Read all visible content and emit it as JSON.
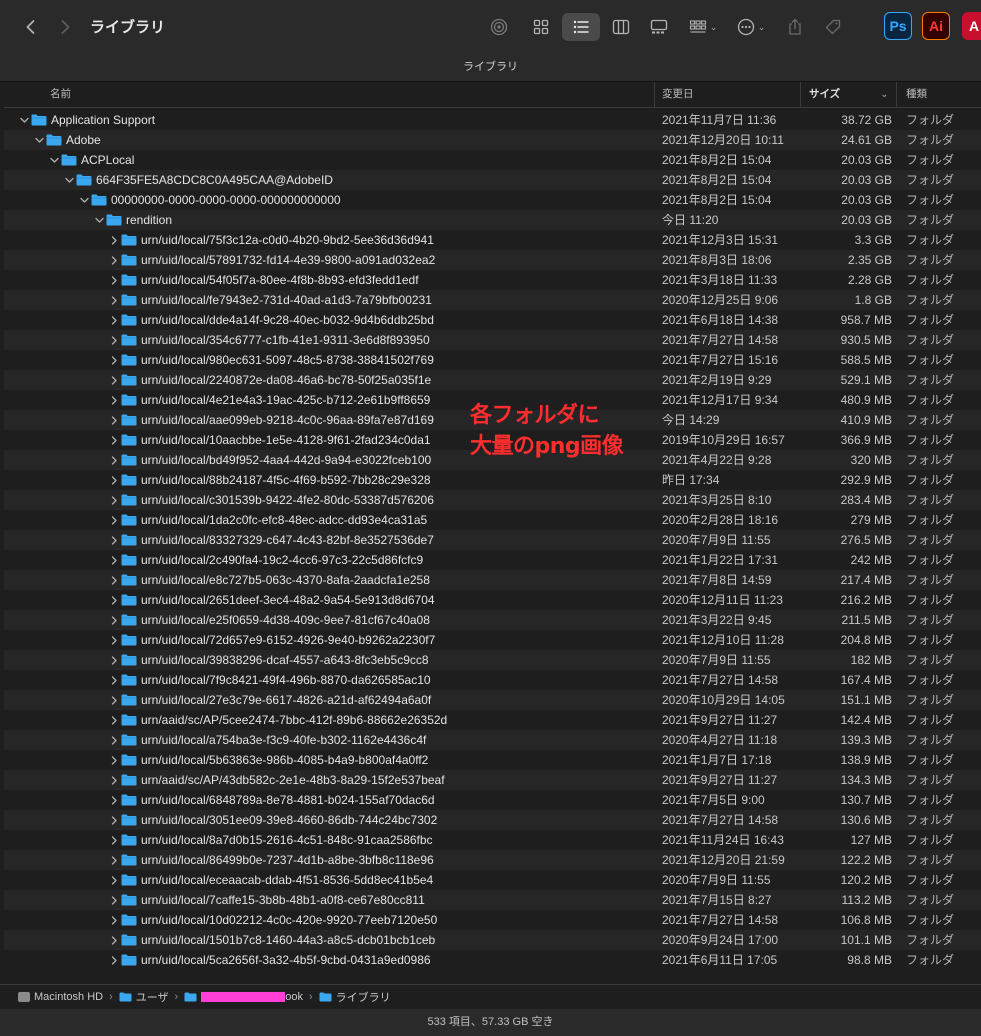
{
  "window": {
    "title": "ライブラリ",
    "path_title": "ライブラリ",
    "status_text": "533 項目、57.33 GB 空き",
    "accent_folder_color": "#3aa8f0"
  },
  "toolbar": {
    "back_icon": "chevron-left-icon",
    "forward_icon": "chevron-right-icon",
    "chevron_glyph": "⌄"
  },
  "apps": {
    "ps_label": "Ps",
    "ai_label": "Ai",
    "acrobat_label": "A"
  },
  "columns": {
    "name": "名前",
    "date": "変更日",
    "size": "サイズ",
    "kind": "種類",
    "sort_glyph": "⌄"
  },
  "annotation": {
    "line1": "各フォルダに",
    "line2": "大量のpng画像"
  },
  "pathbar": {
    "disk": "Macintosh HD",
    "users": "ユーザ",
    "user_suffix": "ook",
    "library": "ライブラリ"
  },
  "rows": [
    {
      "name": "Application Support",
      "date": "2021年11月7日 11:36",
      "size": "38.72 GB",
      "kind": "フォルダ",
      "level": 0,
      "expanded": true
    },
    {
      "name": "Adobe",
      "date": "2021年12月20日 10:11",
      "size": "24.61 GB",
      "kind": "フォルダ",
      "level": 1,
      "expanded": true
    },
    {
      "name": "ACPLocal",
      "date": "2021年8月2日 15:04",
      "size": "20.03 GB",
      "kind": "フォルダ",
      "level": 2,
      "expanded": true
    },
    {
      "name": "664F35FE5A8CDC8C0A495CAA@AdobeID",
      "date": "2021年8月2日 15:04",
      "size": "20.03 GB",
      "kind": "フォルダ",
      "level": 3,
      "expanded": true
    },
    {
      "name": "00000000-0000-0000-0000-000000000000",
      "date": "2021年8月2日 15:04",
      "size": "20.03 GB",
      "kind": "フォルダ",
      "level": 4,
      "expanded": true
    },
    {
      "name": "rendition",
      "date": "今日 11:20",
      "size": "20.03 GB",
      "kind": "フォルダ",
      "level": 5,
      "expanded": true
    },
    {
      "name": "urn/uid/local/75f3c12a-c0d0-4b20-9bd2-5ee36d36d941",
      "date": "2021年12月3日 15:31",
      "size": "3.3 GB",
      "kind": "フォルダ",
      "level": 6,
      "expanded": false
    },
    {
      "name": "urn/uid/local/57891732-fd14-4e39-9800-a091ad032ea2",
      "date": "2021年8月3日 18:06",
      "size": "2.35 GB",
      "kind": "フォルダ",
      "level": 6,
      "expanded": false
    },
    {
      "name": "urn/uid/local/54f05f7a-80ee-4f8b-8b93-efd3fedd1edf",
      "date": "2021年3月18日 11:33",
      "size": "2.28 GB",
      "kind": "フォルダ",
      "level": 6,
      "expanded": false
    },
    {
      "name": "urn/uid/local/fe7943e2-731d-40ad-a1d3-7a79bfb00231",
      "date": "2020年12月25日 9:06",
      "size": "1.8 GB",
      "kind": "フォルダ",
      "level": 6,
      "expanded": false
    },
    {
      "name": "urn/uid/local/dde4a14f-9c28-40ec-b032-9d4b6ddb25bd",
      "date": "2021年6月18日 14:38",
      "size": "958.7 MB",
      "kind": "フォルダ",
      "level": 6,
      "expanded": false
    },
    {
      "name": "urn/uid/local/354c6777-c1fb-41e1-9311-3e6d8f893950",
      "date": "2021年7月27日 14:58",
      "size": "930.5 MB",
      "kind": "フォルダ",
      "level": 6,
      "expanded": false
    },
    {
      "name": "urn/uid/local/980ec631-5097-48c5-8738-38841502f769",
      "date": "2021年7月27日 15:16",
      "size": "588.5 MB",
      "kind": "フォルダ",
      "level": 6,
      "expanded": false
    },
    {
      "name": "urn/uid/local/2240872e-da08-46a6-bc78-50f25a035f1e",
      "date": "2021年2月19日 9:29",
      "size": "529.1 MB",
      "kind": "フォルダ",
      "level": 6,
      "expanded": false
    },
    {
      "name": "urn/uid/local/4e21e4a3-19ac-425c-b712-2e61b9ff8659",
      "date": "2021年12月17日 9:34",
      "size": "480.9 MB",
      "kind": "フォルダ",
      "level": 6,
      "expanded": false
    },
    {
      "name": "urn/uid/local/aae099eb-9218-4c0c-96aa-89fa7e87d169",
      "date": "今日 14:29",
      "size": "410.9 MB",
      "kind": "フォルダ",
      "level": 6,
      "expanded": false
    },
    {
      "name": "urn/uid/local/10aacbbe-1e5e-4128-9f61-2fad234c0da1",
      "date": "2019年10月29日 16:57",
      "size": "366.9 MB",
      "kind": "フォルダ",
      "level": 6,
      "expanded": false
    },
    {
      "name": "urn/uid/local/bd49f952-4aa4-442d-9a94-e3022fceb100",
      "date": "2021年4月22日 9:28",
      "size": "320 MB",
      "kind": "フォルダ",
      "level": 6,
      "expanded": false
    },
    {
      "name": "urn/uid/local/88b24187-4f5c-4f69-b592-7bb28c29e328",
      "date": "昨日 17:34",
      "size": "292.9 MB",
      "kind": "フォルダ",
      "level": 6,
      "expanded": false
    },
    {
      "name": "urn/uid/local/c301539b-9422-4fe2-80dc-53387d576206",
      "date": "2021年3月25日 8:10",
      "size": "283.4 MB",
      "kind": "フォルダ",
      "level": 6,
      "expanded": false
    },
    {
      "name": "urn/uid/local/1da2c0fc-efc8-48ec-adcc-dd93e4ca31a5",
      "date": "2020年2月28日 18:16",
      "size": "279 MB",
      "kind": "フォルダ",
      "level": 6,
      "expanded": false
    },
    {
      "name": "urn/uid/local/83327329-c647-4c43-82bf-8e3527536de7",
      "date": "2020年7月9日 11:55",
      "size": "276.5 MB",
      "kind": "フォルダ",
      "level": 6,
      "expanded": false
    },
    {
      "name": "urn/uid/local/2c490fa4-19c2-4cc6-97c3-22c5d86fcfc9",
      "date": "2021年1月22日 17:31",
      "size": "242 MB",
      "kind": "フォルダ",
      "level": 6,
      "expanded": false
    },
    {
      "name": "urn/uid/local/e8c727b5-063c-4370-8afa-2aadcfa1e258",
      "date": "2021年7月8日 14:59",
      "size": "217.4 MB",
      "kind": "フォルダ",
      "level": 6,
      "expanded": false
    },
    {
      "name": "urn/uid/local/2651deef-3ec4-48a2-9a54-5e913d8d6704",
      "date": "2020年12月11日 11:23",
      "size": "216.2 MB",
      "kind": "フォルダ",
      "level": 6,
      "expanded": false
    },
    {
      "name": "urn/uid/local/e25f0659-4d38-409c-9ee7-81cf67c40a08",
      "date": "2021年3月22日 9:45",
      "size": "211.5 MB",
      "kind": "フォルダ",
      "level": 6,
      "expanded": false
    },
    {
      "name": "urn/uid/local/72d657e9-6152-4926-9e40-b9262a2230f7",
      "date": "2021年12月10日 11:28",
      "size": "204.8 MB",
      "kind": "フォルダ",
      "level": 6,
      "expanded": false
    },
    {
      "name": "urn/uid/local/39838296-dcaf-4557-a643-8fc3eb5c9cc8",
      "date": "2020年7月9日 11:55",
      "size": "182 MB",
      "kind": "フォルダ",
      "level": 6,
      "expanded": false
    },
    {
      "name": "urn/uid/local/7f9c8421-49f4-496b-8870-da626585ac10",
      "date": "2021年7月27日 14:58",
      "size": "167.4 MB",
      "kind": "フォルダ",
      "level": 6,
      "expanded": false
    },
    {
      "name": "urn/uid/local/27e3c79e-6617-4826-a21d-af62494a6a0f",
      "date": "2020年10月29日 14:05",
      "size": "151.1 MB",
      "kind": "フォルダ",
      "level": 6,
      "expanded": false
    },
    {
      "name": "urn/aaid/sc/AP/5cee2474-7bbc-412f-89b6-88662e26352d",
      "date": "2021年9月27日 11:27",
      "size": "142.4 MB",
      "kind": "フォルダ",
      "level": 6,
      "expanded": false
    },
    {
      "name": "urn/uid/local/a754ba3e-f3c9-40fe-b302-1162e4436c4f",
      "date": "2020年4月27日 11:18",
      "size": "139.3 MB",
      "kind": "フォルダ",
      "level": 6,
      "expanded": false
    },
    {
      "name": "urn/uid/local/5b63863e-986b-4085-b4a9-b800af4a0ff2",
      "date": "2021年1月7日 17:18",
      "size": "138.9 MB",
      "kind": "フォルダ",
      "level": 6,
      "expanded": false
    },
    {
      "name": "urn/aaid/sc/AP/43db582c-2e1e-48b3-8a29-15f2e537beaf",
      "date": "2021年9月27日 11:27",
      "size": "134.3 MB",
      "kind": "フォルダ",
      "level": 6,
      "expanded": false
    },
    {
      "name": "urn/uid/local/6848789a-8e78-4881-b024-155af70dac6d",
      "date": "2021年7月5日 9:00",
      "size": "130.7 MB",
      "kind": "フォルダ",
      "level": 6,
      "expanded": false
    },
    {
      "name": "urn/uid/local/3051ee09-39e8-4660-86db-744c24bc7302",
      "date": "2021年7月27日 14:58",
      "size": "130.6 MB",
      "kind": "フォルダ",
      "level": 6,
      "expanded": false
    },
    {
      "name": "urn/uid/local/8a7d0b15-2616-4c51-848c-91caa2586fbc",
      "date": "2021年11月24日 16:43",
      "size": "127 MB",
      "kind": "フォルダ",
      "level": 6,
      "expanded": false
    },
    {
      "name": "urn/uid/local/86499b0e-7237-4d1b-a8be-3bfb8c118e96",
      "date": "2021年12月20日 21:59",
      "size": "122.2 MB",
      "kind": "フォルダ",
      "level": 6,
      "expanded": false
    },
    {
      "name": "urn/uid/local/eceaacab-ddab-4f51-8536-5dd8ec41b5e4",
      "date": "2020年7月9日 11:55",
      "size": "120.2 MB",
      "kind": "フォルダ",
      "level": 6,
      "expanded": false
    },
    {
      "name": "urn/uid/local/7caffe15-3b8b-48b1-a0f8-ce67e80cc811",
      "date": "2021年7月15日 8:27",
      "size": "113.2 MB",
      "kind": "フォルダ",
      "level": 6,
      "expanded": false
    },
    {
      "name": "urn/uid/local/10d02212-4c0c-420e-9920-77eeb7120e50",
      "date": "2021年7月27日 14:58",
      "size": "106.8 MB",
      "kind": "フォルダ",
      "level": 6,
      "expanded": false
    },
    {
      "name": "urn/uid/local/1501b7c8-1460-44a3-a8c5-dcb01bcb1ceb",
      "date": "2020年9月24日 17:00",
      "size": "101.1 MB",
      "kind": "フォルダ",
      "level": 6,
      "expanded": false
    },
    {
      "name": "urn/uid/local/5ca2656f-3a32-4b5f-9cbd-0431a9ed0986",
      "date": "2021年6月11日 17:05",
      "size": "98.8 MB",
      "kind": "フォルダ",
      "level": 6,
      "expanded": false
    }
  ]
}
